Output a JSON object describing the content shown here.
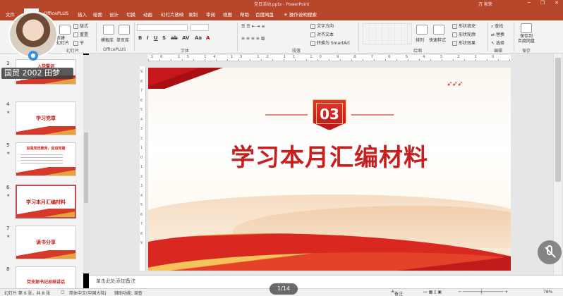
{
  "window": {
    "title": "党日活动.pptx  -  PowerPoint",
    "user": "万 家荣"
  },
  "tabs": [
    {
      "label": "文件"
    },
    {
      "label": "开始"
    },
    {
      "label": "OfficePLUS"
    },
    {
      "label": "插入"
    },
    {
      "label": "绘图"
    },
    {
      "label": "设计"
    },
    {
      "label": "切换"
    },
    {
      "label": "动画"
    },
    {
      "label": "幻灯片放映"
    },
    {
      "label": "录制"
    },
    {
      "label": "审阅"
    },
    {
      "label": "视图"
    },
    {
      "label": "帮助"
    },
    {
      "label": "百度网盘"
    },
    {
      "label": "操作说明搜索"
    }
  ],
  "ribbon": {
    "new_slide": "新建\n幻灯片",
    "layout": "版式",
    "reset": "重置",
    "section": "节",
    "slide_group": "幻灯片",
    "template": "模板库",
    "single_page": "单页库",
    "officeplus_group": "OfficePLUS",
    "font_group": "字体",
    "paragraph_group": "段落",
    "text_direction": "文字方向",
    "align_text": "对齐文本",
    "smartart": "转换为 SmartArt",
    "drawing_group": "绘图",
    "arrange": "排列",
    "quick_styles": "快速样式",
    "shape_fill": "形状填充",
    "shape_outline": "形状轮廓",
    "shape_effects": "形状效果",
    "find": "查找",
    "replace": "替换",
    "select": "选择",
    "editing_group": "编辑",
    "save_to": "保存到\n百度网盘",
    "save_group": "保存"
  },
  "meeting": {
    "participant_name": "国贸 2002 田梦",
    "page_indicator": "1/14"
  },
  "thumbnails": [
    {
      "number": "3",
      "title": "入党誓词"
    },
    {
      "number": "4",
      "title": "学习党章"
    },
    {
      "number": "5",
      "title": "加强党员教育，促进党建"
    },
    {
      "number": "6",
      "title": "学习本月汇编材料"
    },
    {
      "number": "7",
      "title": "读书分享"
    },
    {
      "number": "8",
      "title": "党支部书记总结讲话"
    }
  ],
  "slide": {
    "badge_number": "03",
    "title": "学习本月汇编材料"
  },
  "ruler": {
    "labels": "16 15 14 13 12 11 10 9 8 7 6 5 4 3 2 1 0 1 2 3 4 5 6 7 8 9 10 11 12 13 14 15 16",
    "vlabels": "9876543210123456789"
  },
  "notes": {
    "placeholder": "单击此处添加备注"
  },
  "status": {
    "slide_info": "幻灯片 第 6 张，共 8 张",
    "language": "简体中文(中国大陆)",
    "accessibility": "辅助功能: 调查",
    "notes_btn": "备注",
    "zoom": "78%"
  },
  "colors": {
    "accent": "#b7472a",
    "slide_red": "#c81e1e",
    "slide_gold": "#f4c76e"
  }
}
